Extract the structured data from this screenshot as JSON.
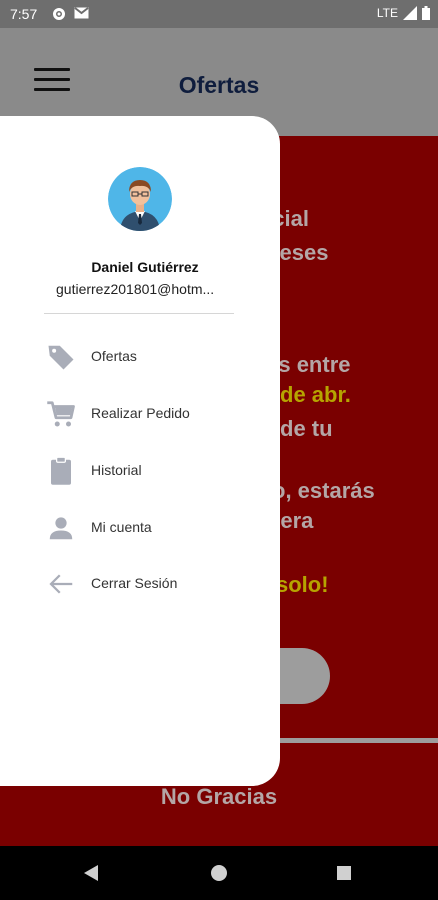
{
  "status_bar": {
    "time": "7:57",
    "network": "LTE"
  },
  "app_bar": {
    "title": "Ofertas"
  },
  "background": {
    "lines": [
      {
        "text": "ecial",
        "color": "light"
      },
      {
        "text": "meses",
        "color": "light"
      },
      {
        "text": "ías entre",
        "color": "light"
      },
      {
        "text": "de abr.",
        "color": "yellow"
      },
      {
        "text": "de tu",
        "color": "light"
      },
      {
        "text": "o, estarás",
        "color": "light"
      },
      {
        "text": "viera",
        "color": "light"
      },
      {
        "text": "solo!",
        "color": "yellow"
      }
    ],
    "no_thanks": "No Gracias"
  },
  "drawer": {
    "user_name": "Daniel Gutiérrez",
    "user_email": "gutierrez201801@hotm...",
    "menu": [
      {
        "label": "Ofertas",
        "icon": "tag-icon"
      },
      {
        "label": "Realizar Pedido",
        "icon": "cart-icon"
      },
      {
        "label": "Historial",
        "icon": "clipboard-icon"
      },
      {
        "label": "Mi cuenta",
        "icon": "person-icon"
      },
      {
        "label": "Cerrar Sesión",
        "icon": "arrow-back-icon"
      }
    ]
  },
  "colors": {
    "content_red": "#7a0000",
    "highlight_yellow": "#b6a400",
    "icon_gray": "#a9adb8",
    "title_navy": "#0f1d3d"
  }
}
